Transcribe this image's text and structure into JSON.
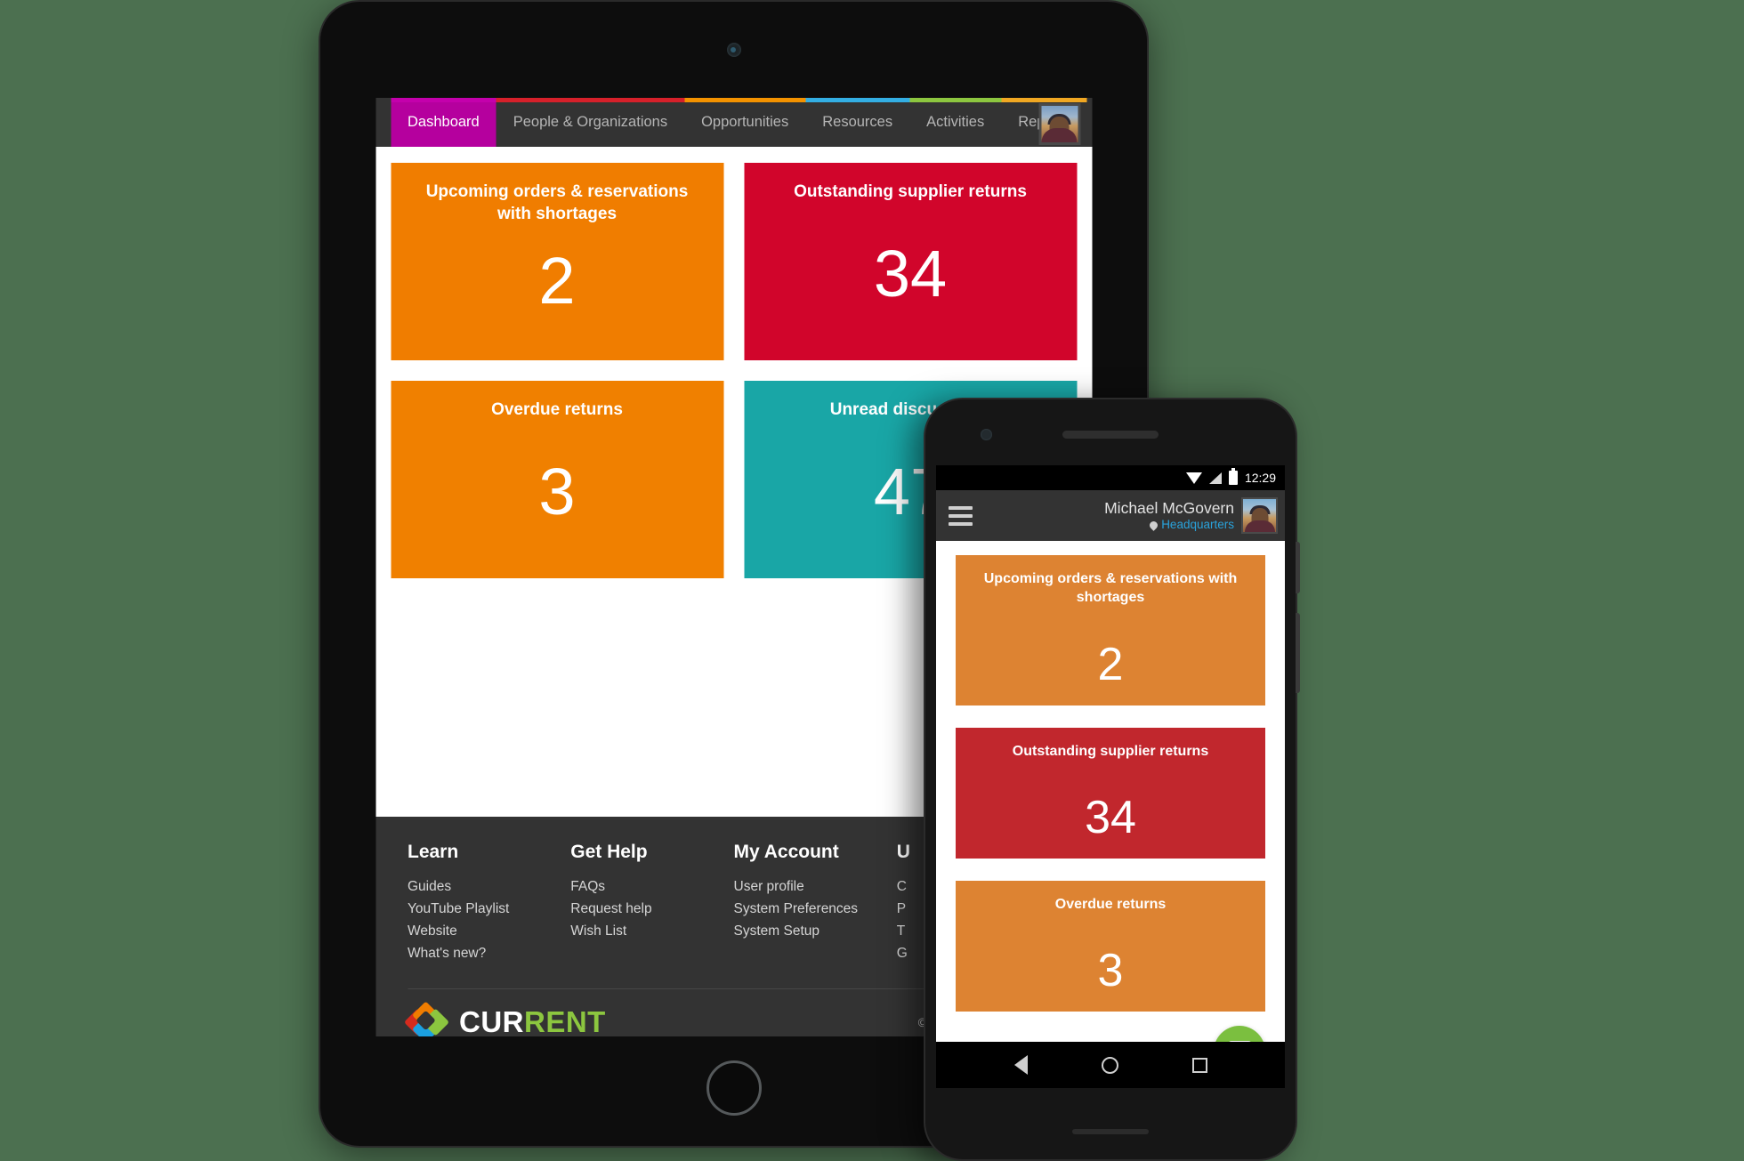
{
  "scene": {
    "background_color": "#4c7050",
    "devices": [
      "tablet",
      "phone"
    ]
  },
  "tablet": {
    "nav": {
      "tabs": [
        {
          "label": "Dashboard",
          "accent": "#C400AC",
          "active": true
        },
        {
          "label": "People & Organizations",
          "accent": "#D6202A",
          "active": false
        },
        {
          "label": "Opportunities",
          "accent": "#F39200",
          "active": false
        },
        {
          "label": "Resources",
          "accent": "#33AEE3",
          "active": false
        },
        {
          "label": "Activities",
          "accent": "#8CC63F",
          "active": false
        },
        {
          "label": "Reports",
          "accent": "#F0A722",
          "active": false
        }
      ],
      "avatar_name": "avatar"
    },
    "tiles": [
      {
        "title": "Upcoming orders & reservations with shortages",
        "value": "2",
        "color": "#F07D00",
        "lines": 2
      },
      {
        "title": "Outstanding supplier returns",
        "value": "34",
        "color": "#D1052B",
        "lines": 1
      },
      {
        "title": "Overdue returns",
        "value": "3",
        "color": "#F08000",
        "lines": 1
      },
      {
        "title": "Unread discussions",
        "value": "47",
        "color": "#19A6A6",
        "lines": 1
      }
    ],
    "footer": {
      "columns": [
        {
          "heading": "Learn",
          "links": [
            "Guides",
            "YouTube Playlist",
            "Website",
            "What's new?"
          ]
        },
        {
          "heading": "Get Help",
          "links": [
            "FAQs",
            "Request help",
            "Wish List"
          ]
        },
        {
          "heading": "My Account",
          "links": [
            "User profile",
            "System Preferences",
            "System Setup"
          ]
        },
        {
          "heading": "U",
          "links": [
            "C",
            "P",
            "T",
            "G"
          ]
        }
      ],
      "logo": {
        "part1": "CUR",
        "part2": "RENT",
        "part2_color": "#8CC63F"
      },
      "copyright": "© Current-RMS Limited 20"
    }
  },
  "phone": {
    "status_bar": {
      "time": "12:29",
      "icons": [
        "wifi-icon",
        "signal-icon",
        "battery-icon"
      ]
    },
    "header": {
      "menu_icon": "hamburger-menu-icon",
      "user_name": "Michael McGovern",
      "location": "Headquarters",
      "location_color": "#29A3DC"
    },
    "tiles": [
      {
        "title": "Upcoming orders & reservations with shortages",
        "value": "2",
        "color": "#DD8332",
        "lines": 2
      },
      {
        "title": "Outstanding supplier returns",
        "value": "34",
        "color": "#C1272D",
        "lines": 1
      },
      {
        "title": "Overdue returns",
        "value": "3",
        "color": "#DD8332",
        "lines": 1
      }
    ],
    "intercom": {
      "name": "chat-bubble-button",
      "color": "#7BBF3F"
    },
    "navbar": {
      "back": "back-icon",
      "home": "home-icon",
      "recents": "recents-icon"
    }
  }
}
